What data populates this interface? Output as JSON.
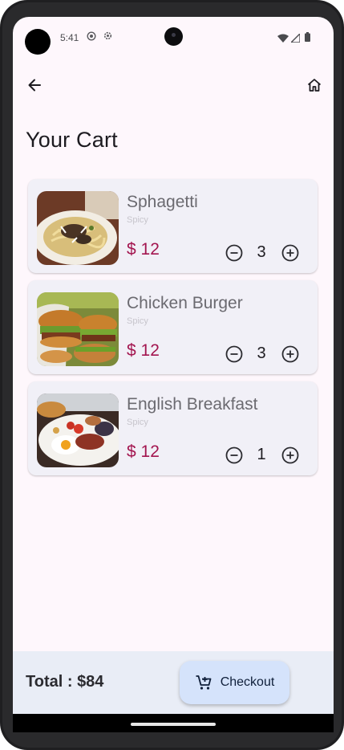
{
  "status_bar": {
    "time": "5:41"
  },
  "page": {
    "title": "Your Cart"
  },
  "cart": {
    "items": [
      {
        "name": "Sphagetti",
        "tag": "Spicy",
        "price": "$ 12",
        "quantity": "3",
        "image": "spaghetti-photo"
      },
      {
        "name": "Chicken Burger",
        "tag": "Spicy",
        "price": "$ 12",
        "quantity": "3",
        "image": "burger-photo"
      },
      {
        "name": "English Breakfast",
        "tag": "Spicy",
        "price": "$ 12",
        "quantity": "1",
        "image": "breakfast-photo"
      }
    ]
  },
  "footer": {
    "total": "Total : $84",
    "checkout_label": "Checkout"
  },
  "colors": {
    "price": "#a3154f",
    "checkout_bg": "#d5e3fb",
    "screen_bg": "#fef7fc",
    "card_bg": "#f1f0f7"
  }
}
